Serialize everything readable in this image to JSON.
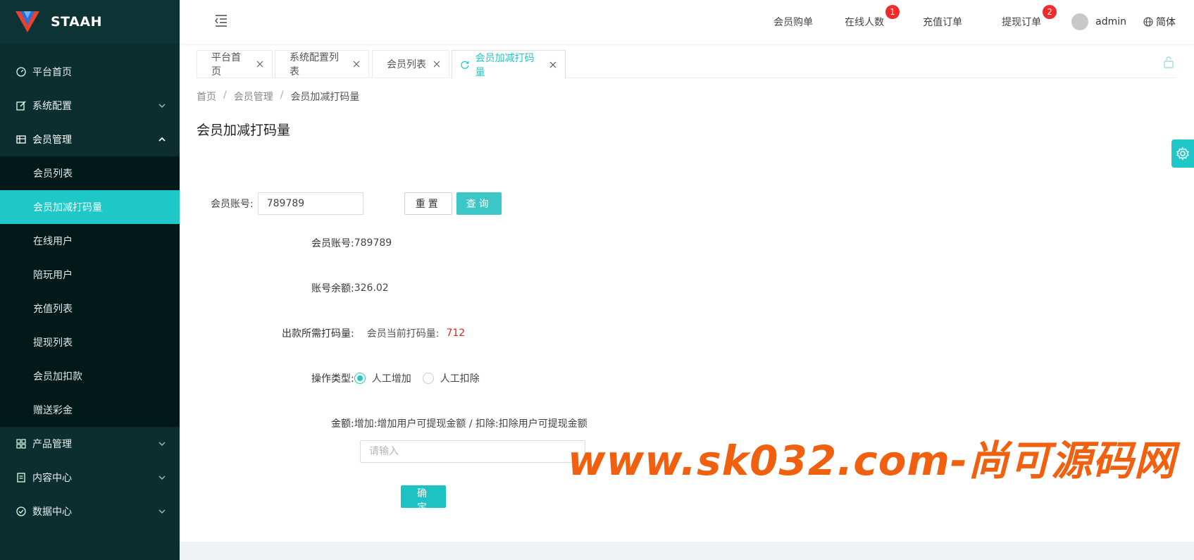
{
  "brand": {
    "name": "STAAH"
  },
  "sidebar": {
    "items": [
      {
        "label": "平台首页",
        "icon": "dashboard-icon"
      },
      {
        "label": "系统配置",
        "icon": "edit-icon"
      },
      {
        "label": "会员管理",
        "icon": "table-icon"
      },
      {
        "label": "产品管理",
        "icon": "grid-icon"
      },
      {
        "label": "内容中心",
        "icon": "document-icon"
      },
      {
        "label": "数据中心",
        "icon": "check-circle-icon"
      }
    ],
    "submenu": [
      "会员列表",
      "会员加减打码量",
      "在线用户",
      "陪玩用户",
      "充值列表",
      "提现列表",
      "会员加扣款",
      "赠送彩金"
    ],
    "active_sub": "会员加减打码量"
  },
  "header": {
    "nav": [
      "会员购单",
      "在线人数",
      "充值订单",
      "提现订单"
    ],
    "badges": {
      "online": "1",
      "withdraw": "2"
    },
    "user": "admin",
    "lang": "简体"
  },
  "tabs": [
    "平台首页",
    "系统配置列表",
    "会员列表",
    "会员加减打码量"
  ],
  "breadcrumb": {
    "home": "首页",
    "parent": "会员管理",
    "current": "会员加减打码量",
    "sep": "/"
  },
  "page_title": "会员加减打码量",
  "search": {
    "label": "会员账号:",
    "value": "789789",
    "reset": "重置",
    "query": "查询"
  },
  "info": {
    "account_label": "会员账号:",
    "account_value": "789789",
    "balance_label": "账号余额:",
    "balance_value": "326.02",
    "required_label": "出款所需打码量:",
    "current_label": "会员当前打码量:",
    "current_value": "712",
    "op_label": "操作类型:",
    "op_add": "人工增加",
    "op_sub": "人工扣除",
    "amount_label": "金额:",
    "amount_hint": "增加:增加用户可提现金额 / 扣除:扣除用户可提现金额",
    "amount_placeholder": "请输入",
    "confirm": "确定"
  },
  "watermark": "www.sk032.com-尚可源码网",
  "colors": {
    "accent": "#1ec8c8",
    "sidebar": "#0c2e2f",
    "submenu": "#02191a",
    "badge": "#f02b2b",
    "highlight": "#d42a1c"
  }
}
